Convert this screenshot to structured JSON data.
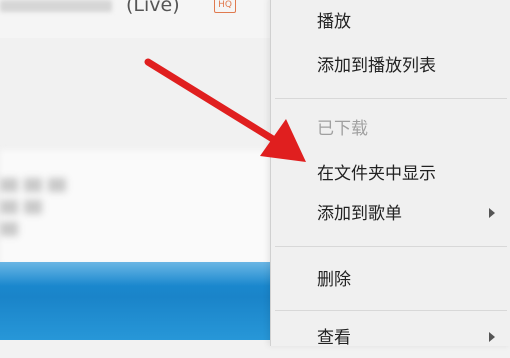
{
  "song": {
    "title_suffix": "(Live)",
    "hd_badge": "HQ"
  },
  "context_menu": {
    "items": [
      {
        "label": "播放",
        "enabled": true,
        "has_submenu": false
      },
      {
        "label": "添加到播放列表",
        "enabled": true,
        "has_submenu": false
      },
      {
        "label": "已下载",
        "enabled": false,
        "has_submenu": false
      },
      {
        "label": "在文件夹中显示",
        "enabled": true,
        "has_submenu": false
      },
      {
        "label": "添加到歌单",
        "enabled": true,
        "has_submenu": true
      },
      {
        "label": "删除",
        "enabled": true,
        "has_submenu": false
      },
      {
        "label": "查看",
        "enabled": true,
        "has_submenu": true
      }
    ]
  },
  "annotation": {
    "type": "arrow",
    "color": "#e01f1f",
    "points_to": "在文件夹中显示"
  },
  "colors": {
    "menu_background": "#f0f0f0",
    "desktop_blue": "#1a84c9",
    "disabled_text": "#a0a0a0"
  }
}
